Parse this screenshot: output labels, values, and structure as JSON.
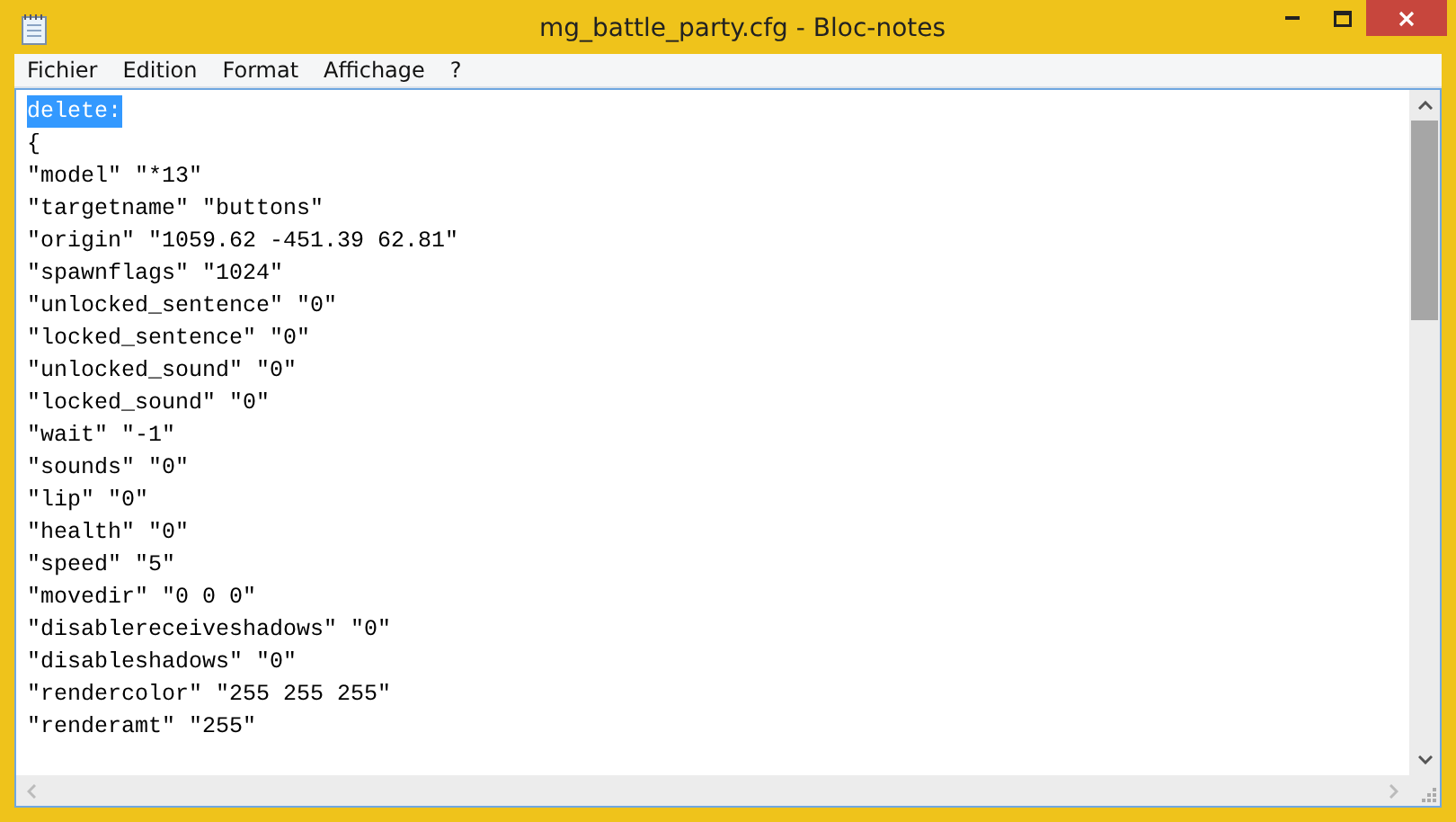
{
  "window": {
    "title": "mg_battle_party.cfg - Bloc-notes"
  },
  "menu": [
    "Fichier",
    "Edition",
    "Format",
    "Affichage",
    "?"
  ],
  "lines": [
    {
      "text": "delete:",
      "selected": true
    },
    {
      "text": "{",
      "selected": false
    },
    {
      "text": "\"model\" \"*13\"",
      "selected": false
    },
    {
      "text": "\"targetname\" \"buttons\"",
      "selected": false
    },
    {
      "text": "\"origin\" \"1059.62 -451.39 62.81\"",
      "selected": false
    },
    {
      "text": "\"spawnflags\" \"1024\"",
      "selected": false
    },
    {
      "text": "\"unlocked_sentence\" \"0\"",
      "selected": false
    },
    {
      "text": "\"locked_sentence\" \"0\"",
      "selected": false
    },
    {
      "text": "\"unlocked_sound\" \"0\"",
      "selected": false
    },
    {
      "text": "\"locked_sound\" \"0\"",
      "selected": false
    },
    {
      "text": "\"wait\" \"-1\"",
      "selected": false
    },
    {
      "text": "\"sounds\" \"0\"",
      "selected": false
    },
    {
      "text": "\"lip\" \"0\"",
      "selected": false
    },
    {
      "text": "\"health\" \"0\"",
      "selected": false
    },
    {
      "text": "\"speed\" \"5\"",
      "selected": false
    },
    {
      "text": "\"movedir\" \"0 0 0\"",
      "selected": false
    },
    {
      "text": "\"disablereceiveshadows\" \"0\"",
      "selected": false
    },
    {
      "text": "\"disableshadows\" \"0\"",
      "selected": false
    },
    {
      "text": "\"rendercolor\" \"255 255 255\"",
      "selected": false
    },
    {
      "text": "\"renderamt\" \"255\"",
      "selected": false
    }
  ]
}
